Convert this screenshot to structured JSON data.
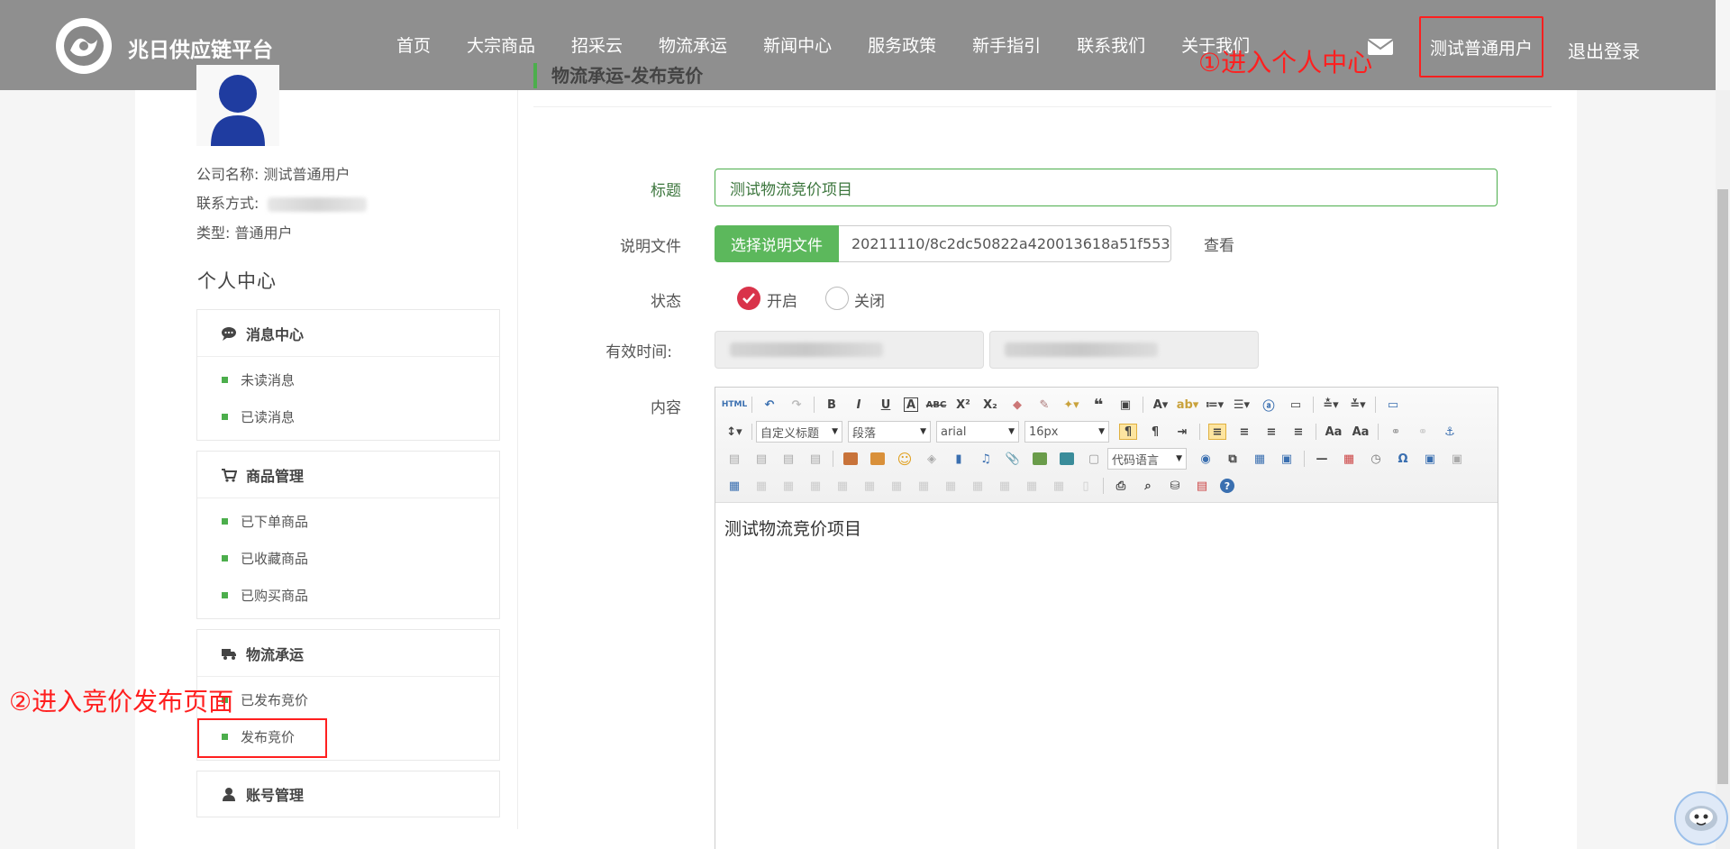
{
  "header": {
    "brand": "兆日供应链平台",
    "nav": [
      "首页",
      "大宗商品",
      "招采云",
      "物流承运",
      "新闻中心",
      "服务政策",
      "新手指引",
      "联系我们",
      "关于我们"
    ],
    "user": "测试普通用户",
    "logout": "退出登录",
    "annotation_1": "①进入个人中心"
  },
  "profile": {
    "company_label": "公司名称:",
    "company_value": "测试普通用户",
    "contact_label": "联系方式:",
    "type_label": "类型:",
    "type_value": "普通用户"
  },
  "sidebar": {
    "title": "个人中心",
    "groups": [
      {
        "title": "消息中心",
        "icon": "chat-icon",
        "items": [
          "未读消息",
          "已读消息"
        ]
      },
      {
        "title": "商品管理",
        "icon": "cart-icon",
        "items": [
          "已下单商品",
          "已收藏商品",
          "已购买商品"
        ]
      },
      {
        "title": "物流承运",
        "icon": "truck-icon",
        "items": [
          "已发布竞价",
          "发布竞价"
        ]
      },
      {
        "title": "账号管理",
        "icon": "user-icon",
        "items": []
      }
    ],
    "annotation_2": "②进入竞价发布页面"
  },
  "form": {
    "page_title": "物流承运-发布竞价",
    "title_label": "标题",
    "title_value": "测试物流竞价项目",
    "file_label": "说明文件",
    "file_button": "选择说明文件",
    "file_name": "20211110/8c2dc50822a420013618a51f553",
    "view_link": "查看",
    "status_label": "状态",
    "status_on": "开启",
    "status_off": "关闭",
    "valid_time_label": "有效时间:",
    "content_label": "内容",
    "editor": {
      "heading_select": "自定义标题",
      "paragraph_select": "段落",
      "font_select": "arial",
      "size_select": "16px",
      "code_select": "代码语言",
      "body": "测试物流竞价项目"
    }
  }
}
